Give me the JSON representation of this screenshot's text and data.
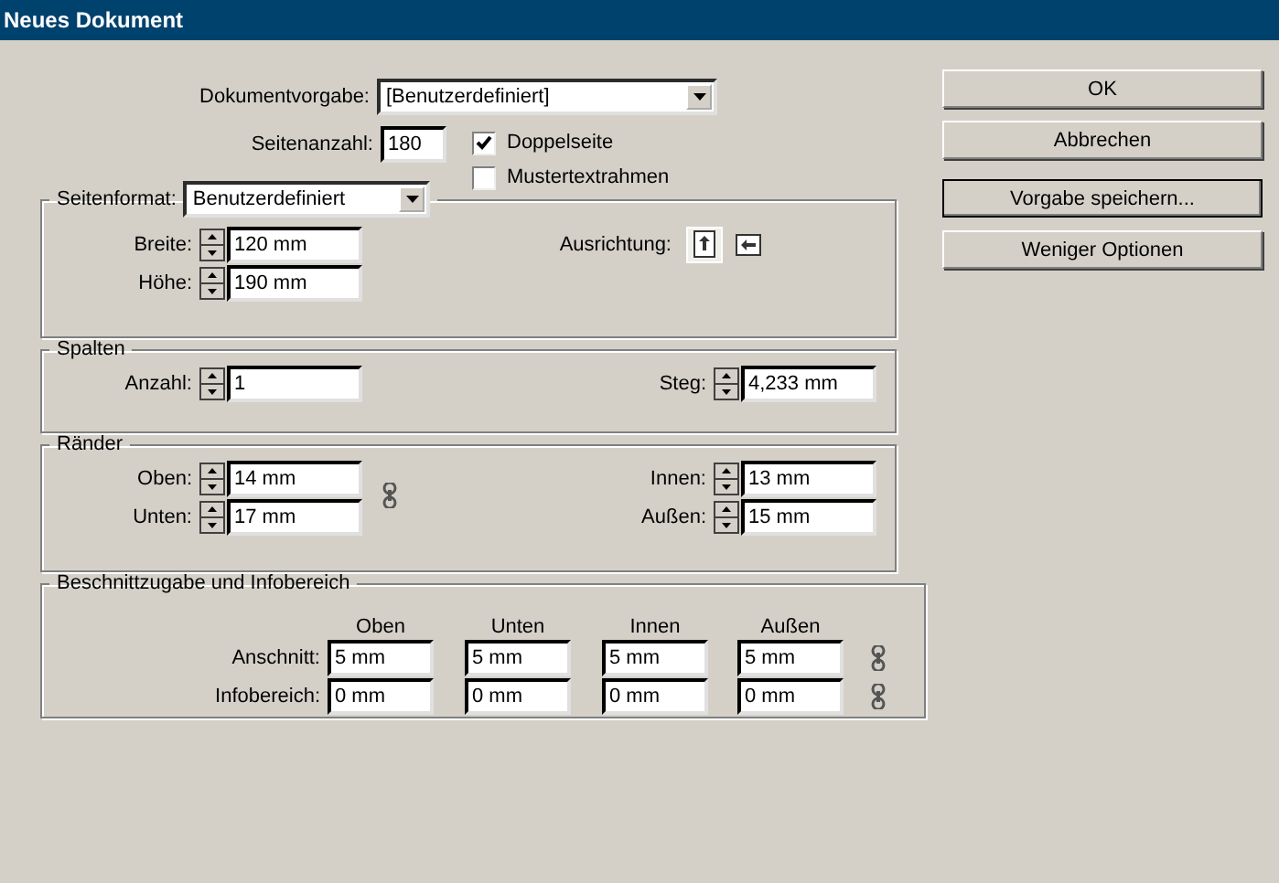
{
  "window": {
    "title": "Neues Dokument"
  },
  "preset": {
    "label": "Dokumentvorgabe:",
    "value": "[Benutzerdefiniert]"
  },
  "pages": {
    "label": "Seitenanzahl:",
    "value": "180"
  },
  "checkboxes": [
    {
      "label": "Doppelseite",
      "checked": true
    },
    {
      "label": "Mustertextrahmen",
      "checked": false
    }
  ],
  "page_size": {
    "label": "Seitenformat:",
    "value": "Benutzerdefiniert",
    "fields": [
      {
        "label": "Breite:",
        "value": "120 mm"
      },
      {
        "label": "Höhe:",
        "value": "190 mm"
      }
    ],
    "orientation": {
      "label": "Ausrichtung:",
      "options": [
        {
          "kind": "portrait",
          "selected": true
        },
        {
          "kind": "landscape",
          "selected": false
        }
      ]
    }
  },
  "columns": {
    "title": "Spalten",
    "left": [
      {
        "label": "Anzahl:",
        "value": "1"
      }
    ],
    "right": [
      {
        "label": "Steg:",
        "value": "4,233 mm"
      }
    ]
  },
  "margins": {
    "title": "Ränder",
    "left": [
      {
        "label": "Oben:",
        "value": "14 mm"
      },
      {
        "label": "Unten:",
        "value": "17 mm"
      }
    ],
    "right": [
      {
        "label": "Innen:",
        "value": "13 mm"
      },
      {
        "label": "Außen:",
        "value": "15 mm"
      }
    ]
  },
  "bleed": {
    "title": "Beschnittzugabe und Infobereich",
    "headers": [
      "Oben",
      "Unten",
      "Innen",
      "Außen"
    ],
    "rows": [
      {
        "label": "Anschnitt:",
        "values": [
          "5 mm",
          "5 mm",
          "5 mm",
          "5 mm"
        ]
      },
      {
        "label": "Infobereich:",
        "values": [
          "0 mm",
          "0 mm",
          "0 mm",
          "0 mm"
        ]
      }
    ]
  },
  "buttons": [
    {
      "label": "OK",
      "focused": false
    },
    {
      "label": "Abbrechen",
      "focused": false
    },
    {
      "label": "Vorgabe speichern...",
      "focused": true
    },
    {
      "label": "Weniger Optionen",
      "focused": false
    }
  ]
}
